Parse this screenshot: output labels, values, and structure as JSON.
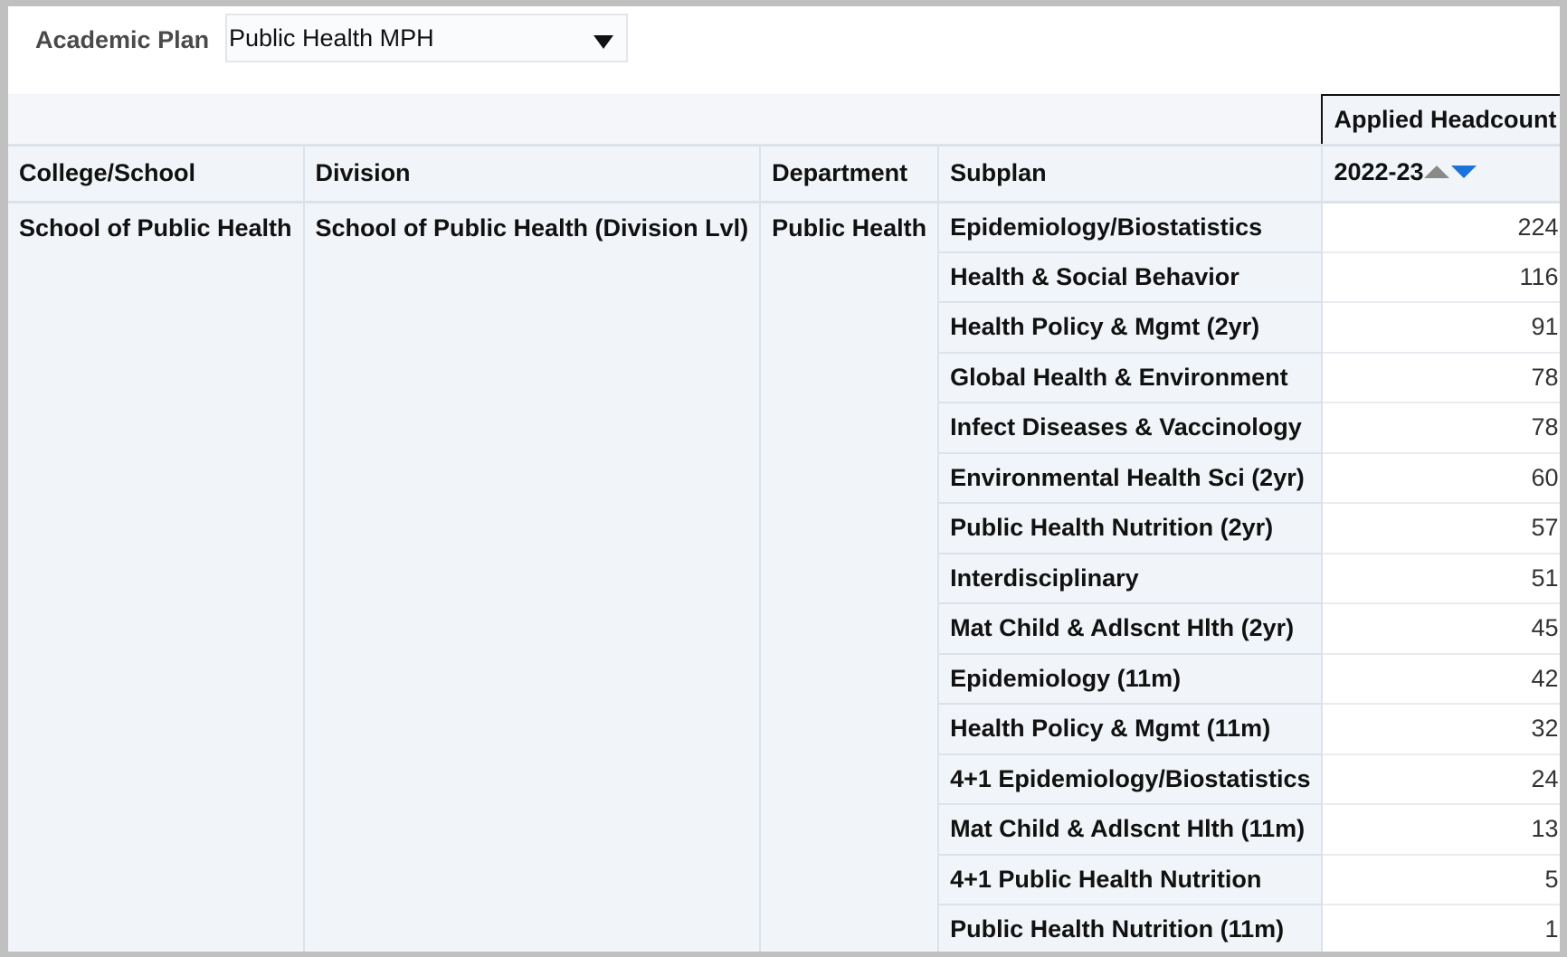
{
  "prompt": {
    "label": "Academic Plan",
    "selected_value": "Public Health MPH"
  },
  "table": {
    "measure_header": "Applied Headcount",
    "columns": [
      "College/School",
      "Division",
      "Department",
      "Subplan",
      "2022-23"
    ],
    "sort": {
      "column": "2022-23",
      "direction": "descending",
      "up_color": "#8a8a8a",
      "down_color": "#1a73d9"
    },
    "college": "School of Public Health",
    "division": "School of Public Health (Division Lvl)",
    "department": "Public Health",
    "rows": [
      {
        "subplan": "Epidemiology/Biostatistics",
        "value": "224"
      },
      {
        "subplan": "Health & Social Behavior",
        "value": "116"
      },
      {
        "subplan": "Health Policy & Mgmt (2yr)",
        "value": "91"
      },
      {
        "subplan": "Global Health & Environment",
        "value": "78"
      },
      {
        "subplan": "Infect Diseases & Vaccinology",
        "value": "78"
      },
      {
        "subplan": "Environmental Health Sci (2yr)",
        "value": "60"
      },
      {
        "subplan": "Public Health Nutrition (2yr)",
        "value": "57"
      },
      {
        "subplan": "Interdisciplinary",
        "value": "51"
      },
      {
        "subplan": "Mat Child & Adlscnt Hlth (2yr)",
        "value": "45"
      },
      {
        "subplan": "Epidemiology (11m)",
        "value": "42"
      },
      {
        "subplan": "Health Policy & Mgmt (11m)",
        "value": "32"
      },
      {
        "subplan": "4+1 Epidemiology/Biostatistics",
        "value": "24"
      },
      {
        "subplan": "Mat Child & Adlscnt Hlth (11m)",
        "value": "13"
      },
      {
        "subplan": "4+1 Public Health Nutrition",
        "value": "5"
      },
      {
        "subplan": "Public Health Nutrition (11m)",
        "value": "1"
      }
    ]
  }
}
